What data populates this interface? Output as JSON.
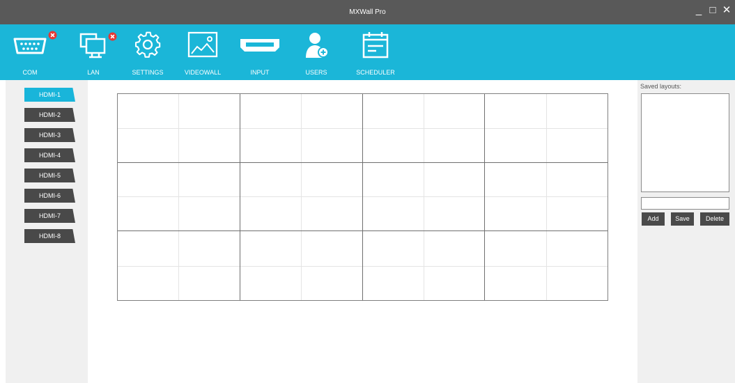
{
  "window": {
    "title": "MXWall Pro"
  },
  "toolbar": {
    "items": [
      {
        "label": "COM",
        "icon": "serial-port-icon"
      },
      {
        "label": "LAN",
        "icon": "network-monitor-icon"
      },
      {
        "label": "SETTINGS",
        "icon": "gear-icon"
      },
      {
        "label": "VIDEOWALL",
        "icon": "image-icon"
      },
      {
        "label": "INPUT",
        "icon": "hdmi-port-icon"
      },
      {
        "label": "USERS",
        "icon": "add-user-icon"
      },
      {
        "label": "SCHEDULER",
        "icon": "calendar-icon"
      }
    ]
  },
  "inputs": [
    "HDMI-1",
    "HDMI-2",
    "HDMI-3",
    "HDMI-4",
    "HDMI-5",
    "HDMI-6",
    "HDMI-7",
    "HDMI-8"
  ],
  "selected_input": "HDMI-1",
  "videowall": {
    "columns": 4,
    "rows": 3
  },
  "layouts": {
    "label": "Saved layouts:",
    "name_value": "",
    "add_label": "Add",
    "save_label": "Save",
    "delete_label": "Delete"
  },
  "colors": {
    "accent": "#1bb6d8",
    "titlebar": "#595959",
    "tab": "#494949",
    "error": "#e53935"
  }
}
